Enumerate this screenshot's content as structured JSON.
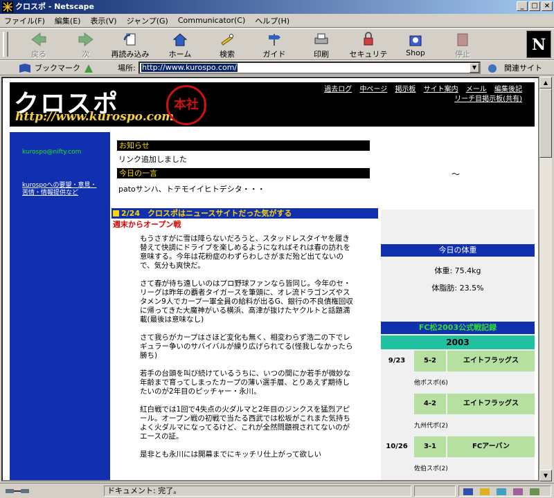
{
  "window": {
    "title": "クロスポ - Netscape",
    "controls": [
      "_",
      "□",
      "×"
    ]
  },
  "menu": [
    "ファイル(F)",
    "編集(E)",
    "表示(V)",
    "ジャンプ(G)",
    "Communicator(C)",
    "ヘルプ(H)"
  ],
  "toolbar": {
    "back": "戻る",
    "forward": "次",
    "reload": "再読み込み",
    "home": "ホーム",
    "search": "検索",
    "guide": "ガイド",
    "print": "印刷",
    "security": "セキュリティ",
    "shop": "Shop",
    "stop": "停止",
    "brand": "N"
  },
  "location": {
    "bookmarks": "ブックマーク",
    "label": "場所:",
    "url": "http://www.kurospo.com/",
    "related": "関連サイト"
  },
  "status": {
    "message": "ドキュメント: 完了。"
  },
  "page": {
    "logo": "クロスポ",
    "logo_url": "http://www.kurospo.com",
    "stamp": "本社",
    "nav_row1": [
      "過去ログ",
      "中ページ",
      "掲示板",
      "サイト案内",
      "メール",
      "編集後記"
    ],
    "nav_row2": "リーチ目掲示板(共有)",
    "sidebar_line1": "kurospo@nifty.com",
    "sidebar_line2": "kurospoへの要望・意見・苦情・情報提供など",
    "notice1_title": "お知らせ",
    "notice1_body": "リンク追加しました",
    "notice2_title": "今日の一言",
    "notice2_body": "patoサンハ、トテモイイヒトデシタ・・・",
    "tilde": "～",
    "article_title": "2/24　クロスポはニュースサイトだった気がする",
    "article_sub": "週末からオープン戦",
    "paragraphs": [
      "もうさすがに雪は降らないだろうと、スタッドレスタイヤを履き替えて快調にドライブを楽しめるようになればそれは春の訪れを意味する。今年は花粉症のわずらわしさがまだ殆ど出てないので、気分も爽快だ。",
      "さて春が待ち遠しいのはプロ野球ファンなら皆同じ。今年のセ・リーグは昨年の覇者タイガースを筆頭に、オレ流ドラゴンズやスタメン9人でカープ一軍全員の給料が出るG、銀行の不良債権回収に帰ってきた大魔神がいる横浜、高津が抜けたヤクルトと話題満載(最後は意味なし)",
      "さて我らがカープはさほど変化も無く、相変わらず浩二の下でレギュラー争いのサバイバルが繰り広げられてる(怪我しなかったら勝ち)",
      "若手の台頭を叫び続けているうちに、いつの間にか若手が微妙な年齢まで育ってしまったカープの薄い選手層、とりあえず期待したいのが2年目のピッチャー・永川。",
      "紅白戦では1回で4失点の火ダルマと2年目のジンクスを猛烈アピール。オープン戦の初戦で当たる西武では松坂がこれまた気持ちよく火ダルマになってるけど、これが全然問題視されてないのがエースの証。",
      "是非とも永川には開幕までにキッチリ仕上がって欲しい"
    ],
    "weight_title": "今日の体重",
    "weight": "体重: 75.4kg",
    "bodyfat": "体脂肪: 23.5%",
    "fc_title": "FC松2003公式戦記録",
    "year": "2003",
    "games": [
      {
        "date": "9/23",
        "score": "5-2",
        "opponent": "エイトフラッグス",
        "source": "他ポスポ(6)"
      },
      {
        "date": "",
        "score": "4-2",
        "opponent": "エイトフラッグス",
        "source": "九州代ポ(2)"
      },
      {
        "date": "10/26",
        "score": "3-1",
        "opponent": "FCアーバン",
        "source": "佐伯スポ(2)"
      }
    ]
  }
}
